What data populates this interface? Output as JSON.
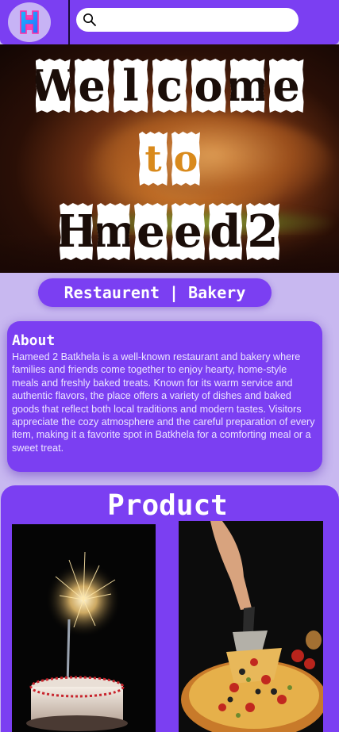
{
  "header": {
    "logo_label": "Hameed 2 logo",
    "search": {
      "placeholder": "",
      "value": ""
    }
  },
  "hero": {
    "line1": [
      "W",
      "e",
      "l",
      "c",
      "o",
      "m",
      "e"
    ],
    "line2": [
      "t",
      "o"
    ],
    "line3": [
      "H",
      "m",
      "e",
      "e",
      "d",
      "2"
    ]
  },
  "category": "Restaurent | Bakery",
  "about": {
    "title": "About",
    "text": "Hameed 2 Batkhela is a well-known restaurant and bakery where families and friends come together to enjoy hearty, home-style meals and freshly baked treats. Known for its warm service and authentic flavors, the place offers a variety of dishes and baked goods that reflect both local traditions and modern tastes. Visitors appreciate the cozy atmosphere and the careful preparation of every item, making it a favorite spot in Batkhela for a comforting meal or a sweet treat."
  },
  "products": {
    "title": "Product",
    "items": [
      {
        "image": "birthday-cake-sparkler-image"
      },
      {
        "image": "pizza-slice-image"
      }
    ]
  },
  "colors": {
    "accent": "#7b3ff2",
    "page_bg": "#c8b8f0",
    "logo_bg": "#c7b3f5"
  }
}
